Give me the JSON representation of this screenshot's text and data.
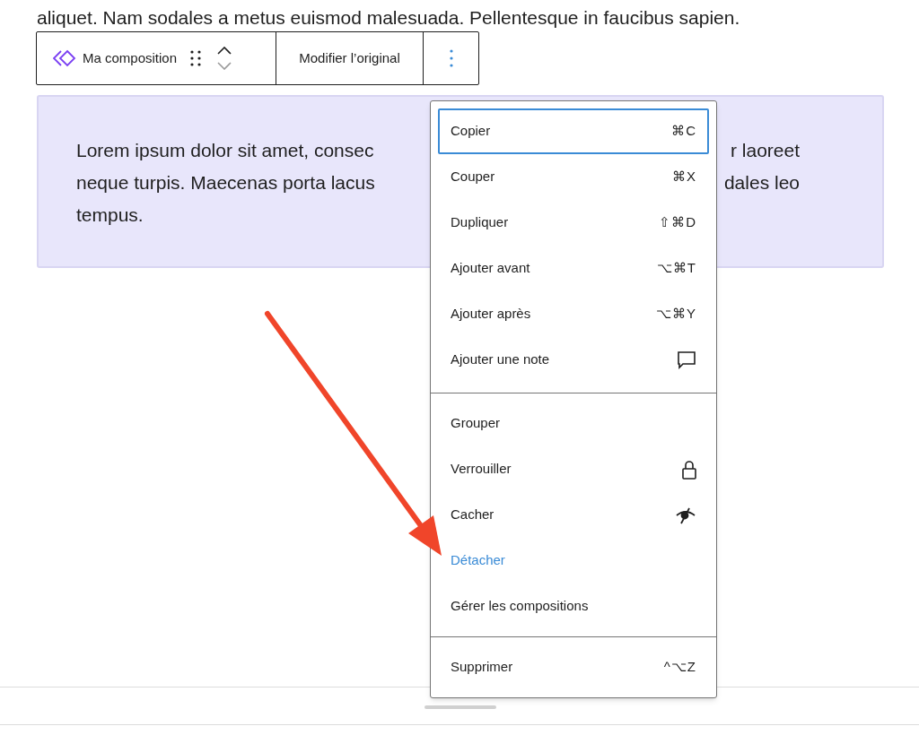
{
  "intro_text": "aliquet. Nam sodales a metus euismod malesuada. Pellentesque in faucibus sapien.",
  "toolbar": {
    "block_name": "Ma composition",
    "edit_button": "Modifier l’original"
  },
  "paragraph": {
    "lines": [
      {
        "left": "Lorem ipsum dolor sit amet, consec",
        "right": "r laoreet"
      },
      {
        "left": "neque turpis. Maecenas porta lacus",
        "right": "dales leo"
      },
      {
        "left": "tempus."
      }
    ]
  },
  "menu": {
    "groups": [
      [
        {
          "label": "Copier",
          "kind": "shortcut",
          "shortcut": "⌘C",
          "focused": true,
          "active": false
        },
        {
          "label": "Couper",
          "kind": "shortcut",
          "shortcut": "⌘X",
          "focused": false,
          "active": false
        },
        {
          "label": "Dupliquer",
          "kind": "shortcut",
          "shortcut": "⇧⌘D",
          "focused": false,
          "active": false
        },
        {
          "label": "Ajouter avant",
          "kind": "shortcut",
          "shortcut": "⌥⌘T",
          "focused": false,
          "active": false
        },
        {
          "label": "Ajouter après",
          "kind": "shortcut",
          "shortcut": "⌥⌘Y",
          "focused": false,
          "active": false
        },
        {
          "label": "Ajouter une note",
          "kind": "comment",
          "focused": false,
          "active": false
        }
      ],
      [
        {
          "label": "Grouper",
          "kind": "plain",
          "focused": false,
          "active": false
        },
        {
          "label": "Verrouiller",
          "kind": "lock",
          "focused": false,
          "active": false
        },
        {
          "label": "Cacher",
          "kind": "hide",
          "focused": false,
          "active": false
        },
        {
          "label": "Détacher",
          "kind": "plain",
          "focused": false,
          "active": true
        },
        {
          "label": "Gérer les compositions",
          "kind": "plain",
          "focused": false,
          "active": false
        }
      ],
      [
        {
          "label": "Supprimer",
          "kind": "shortcut",
          "shortcut": "^⌥Z",
          "focused": false,
          "active": false
        }
      ]
    ]
  }
}
